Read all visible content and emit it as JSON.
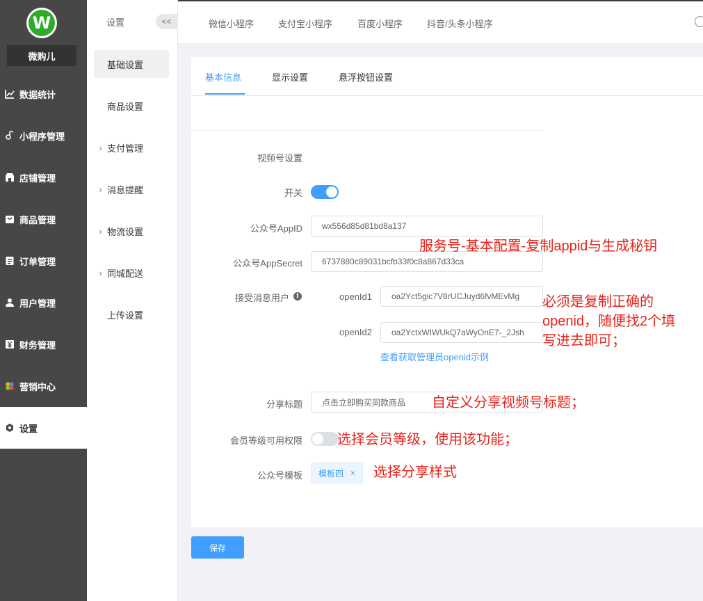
{
  "brand": {
    "logo_letter": "W",
    "name": "微购儿"
  },
  "main_nav": [
    {
      "label": "数据统计",
      "icon": "chart-icon"
    },
    {
      "label": "小程序管理",
      "icon": "link-icon"
    },
    {
      "label": "店铺管理",
      "icon": "store-icon"
    },
    {
      "label": "商品管理",
      "icon": "goods-icon"
    },
    {
      "label": "订单管理",
      "icon": "order-icon"
    },
    {
      "label": "用户管理",
      "icon": "user-icon"
    },
    {
      "label": "财务管理",
      "icon": "finance-icon"
    },
    {
      "label": "营销中心",
      "icon": "marketing-icon"
    },
    {
      "label": "设置",
      "icon": "gear-icon",
      "active": true
    }
  ],
  "sub_nav": {
    "title": "设置",
    "collapse_label": "<<",
    "items": [
      {
        "label": "基础设置",
        "active": true
      },
      {
        "label": "商品设置"
      },
      {
        "label": "支付管理",
        "expandable": true
      },
      {
        "label": "消息提醒",
        "expandable": true
      },
      {
        "label": "物流设置",
        "expandable": true
      },
      {
        "label": "同城配送",
        "expandable": true
      },
      {
        "label": "上传设置"
      }
    ]
  },
  "top_tabs": [
    "微信小程序",
    "支付宝小程序",
    "百度小程序",
    "抖音/头条小程序"
  ],
  "content_tabs": {
    "items": [
      "基本信息",
      "显示设置",
      "悬浮按钮设置"
    ],
    "active": "基本信息"
  },
  "form": {
    "section_title": "视频号设置",
    "switch_label": "开关",
    "switch_on": true,
    "appid_label": "公众号AppID",
    "appid_value": "wx556d85d81bd8a137",
    "appsecret_label": "公众号AppSecret",
    "appsecret_value": "6737880c89031bcfb33f0c8a867d33ca",
    "receiver_label": "接受消息用户",
    "openid1_label": "openId1",
    "openid1_value": "oa2Yct5gic7V8rUCJuyd6fvMEvMg",
    "openid2_label": "openId2",
    "openid2_value": "oa2YctxWIWUkQ7aWyOnE7-_2Jsh",
    "openid_help_link": "查看获取管理员openid示例",
    "share_title_label": "分享标题",
    "share_title_value": "点击立即购买同款商品",
    "member_level_label": "会员等级可用权限",
    "member_level_on": false,
    "template_label": "公众号模板",
    "template_tag": "模板四"
  },
  "annotations": {
    "appid_note": "服务号-基本配置-复制appid与生成秘钥",
    "openid_note_1": "必须是复制正确的",
    "openid_note_2": "openid，随便找2个填",
    "openid_note_3": "写进去即可；",
    "share_note": "自定义分享视频号标题；",
    "member_note": "选择会员等级，使用该功能；",
    "template_note": "选择分享样式"
  },
  "save_label": "保存",
  "colors": {
    "primary": "#409eff",
    "sidebar": "#474747",
    "annotation": "#e8231b",
    "logo_green": "#2eab2b"
  }
}
